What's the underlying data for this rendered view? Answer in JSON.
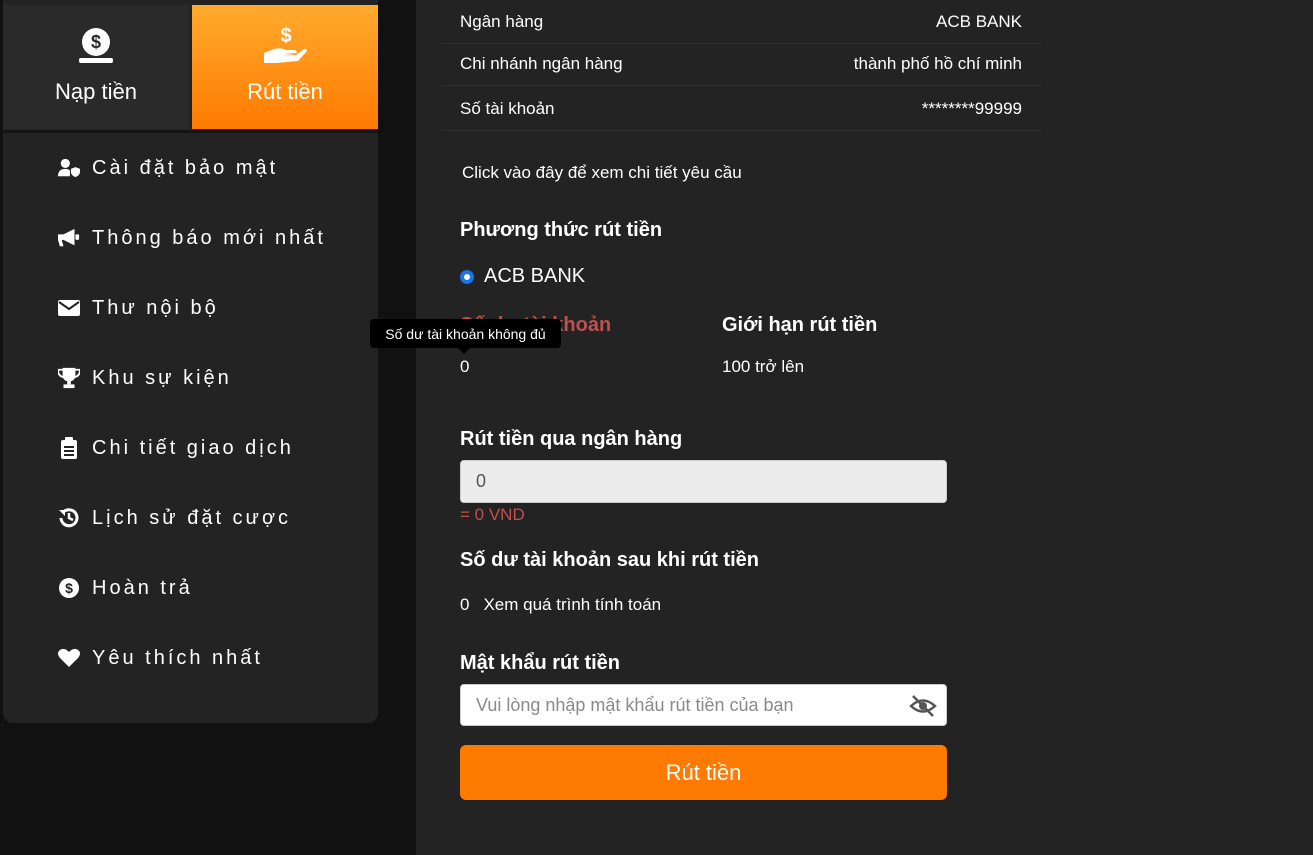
{
  "sidebar": {
    "tabs": [
      {
        "label": "Nạp tiền",
        "icon": "dollar-coin-icon"
      },
      {
        "label": "Rút tiền",
        "icon": "hand-dollar-icon"
      }
    ],
    "items": [
      {
        "label": "Cài đặt bảo mật",
        "icon": "user-shield-icon"
      },
      {
        "label": "Thông báo mới nhất",
        "icon": "megaphone-icon"
      },
      {
        "label": "Thư nội bộ",
        "icon": "envelope-icon"
      },
      {
        "label": "Khu sự kiện",
        "icon": "trophy-icon"
      },
      {
        "label": "Chi tiết giao dịch",
        "icon": "clipboard-icon"
      },
      {
        "label": "Lịch sử đặt cược",
        "icon": "history-icon"
      },
      {
        "label": "Hoàn trả",
        "icon": "dollar-circle-icon"
      },
      {
        "label": "Yêu thích nhất",
        "icon": "heart-icon"
      }
    ]
  },
  "bank_info": {
    "rows": [
      {
        "label": "Ngân hàng",
        "value": "ACB BANK"
      },
      {
        "label": "Chi nhánh ngân hàng",
        "value": "thành phố hồ chí minh"
      },
      {
        "label": "Số tài khoản",
        "value": "********99999"
      }
    ],
    "details_link": "Click vào đây để xem chi tiết yêu cầu"
  },
  "method": {
    "heading": "Phương thức rút tiền",
    "option": "ACB BANK"
  },
  "balance": {
    "heading": "Số dư tài khoản",
    "value": "0",
    "tooltip": "Số dư tài khoản không đủ"
  },
  "limit": {
    "heading": "Giới hạn rút tiền",
    "value": "100 trở lên"
  },
  "withdraw": {
    "heading": "Rút tiền qua ngân hàng",
    "amount_value": "0",
    "converted": "= 0 VND"
  },
  "after": {
    "heading": "Số dư tài khoản sau khi rút tiền",
    "value": "0",
    "calc_link": "Xem quá trình tính toán"
  },
  "password": {
    "heading": "Mật khẩu rút tiền",
    "placeholder": "Vui lòng nhập mật khẩu rút tiền của bạn"
  },
  "submit_label": "Rút tiền",
  "colors": {
    "accent": "#ff7a00",
    "error": "#c0504d",
    "panel": "#232323"
  }
}
